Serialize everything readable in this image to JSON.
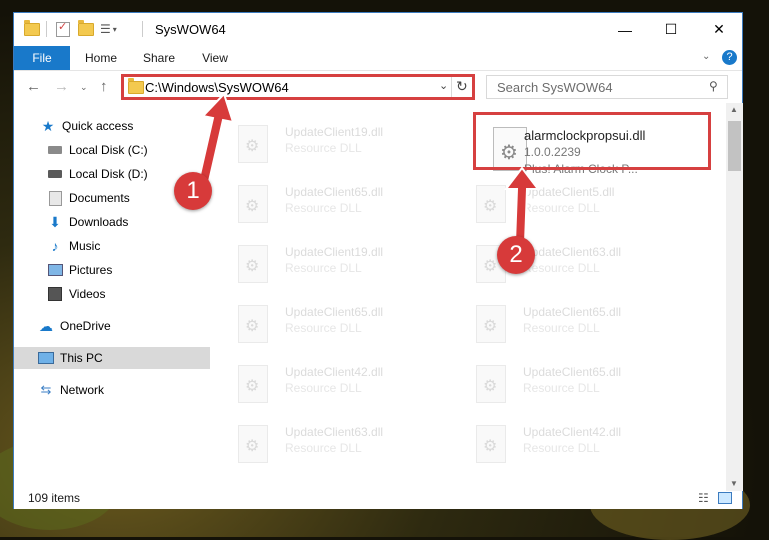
{
  "window": {
    "title": "SysWOW64"
  },
  "window_controls": {
    "minimize": "—",
    "maximize": "☐",
    "close": "✕"
  },
  "ribbon": {
    "tabs": [
      "File",
      "Home",
      "Share",
      "View"
    ]
  },
  "address": {
    "path": "C:\\Windows\\SysWOW64"
  },
  "search": {
    "placeholder": "Search SysWOW64"
  },
  "nav": {
    "items": [
      {
        "label": "Quick access"
      },
      {
        "label": "Local Disk (C:)"
      },
      {
        "label": "Local Disk (D:)"
      },
      {
        "label": "Documents"
      },
      {
        "label": "Downloads"
      },
      {
        "label": "Music"
      },
      {
        "label": "Pictures"
      },
      {
        "label": "Videos"
      },
      {
        "label": "OneDrive"
      },
      {
        "label": "This PC"
      },
      {
        "label": "Network"
      }
    ]
  },
  "selected_file": {
    "name": "alarmclockpropsui.dll",
    "version": "1.0.0.2239",
    "description": "Plus! Alarm Clock P..."
  },
  "files": [
    {
      "name": "UpdateClient19.dll",
      "type": "Resource DLL"
    },
    {
      "name": "UpdateClient65.dll",
      "type": "Resource DLL"
    },
    {
      "name": "UpdateClient5.dll",
      "type": "Resource DLL"
    },
    {
      "name": "UpdateClient19.dll",
      "type": "Resource DLL"
    },
    {
      "name": "UpdateClient63.dll",
      "type": "Resource DLL"
    },
    {
      "name": "UpdateClient65.dll",
      "type": "Resource DLL"
    },
    {
      "name": "UpdateClient65.dll",
      "type": "Resource DLL"
    },
    {
      "name": "UpdateClient42.dll",
      "type": "Resource DLL"
    },
    {
      "name": "UpdateClient65.dll",
      "type": "Resource DLL"
    },
    {
      "name": "UpdateClient63.dll",
      "type": "Resource DLL"
    },
    {
      "name": "UpdateClient42.dll",
      "type": "Resource DLL"
    }
  ],
  "status": {
    "count": "109 items"
  },
  "callouts": {
    "one": "1",
    "two": "2"
  },
  "colors": {
    "accent": "#1979ca",
    "highlight": "#d64040",
    "selection": "#cce8ff"
  }
}
